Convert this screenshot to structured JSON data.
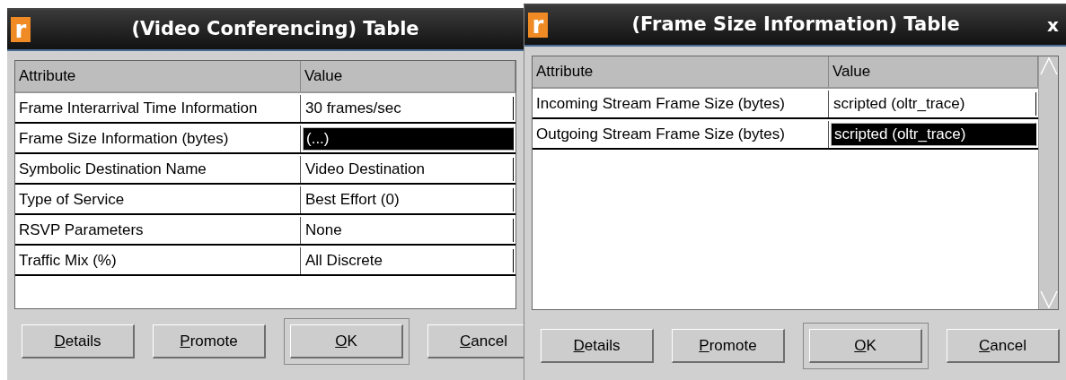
{
  "windows": [
    {
      "title": "(Video Conferencing) Table",
      "app_icon": "r",
      "scrollbar": false,
      "table": {
        "columns": [
          "Attribute",
          "Value"
        ],
        "rows": [
          {
            "attribute": "Frame Interarrival Time Information",
            "value": "30 frames/sec",
            "selected": false
          },
          {
            "attribute": "Frame Size Information (bytes)",
            "value": "(...)",
            "selected": true
          },
          {
            "attribute": "Symbolic Destination Name",
            "value": "Video Destination",
            "selected": false
          },
          {
            "attribute": "Type of Service",
            "value": "Best Effort (0)",
            "selected": false
          },
          {
            "attribute": "RSVP Parameters",
            "value": "None",
            "selected": false
          },
          {
            "attribute": "Traffic Mix (%)",
            "value": "All Discrete",
            "selected": false
          }
        ]
      },
      "buttons": [
        {
          "label": "Details",
          "default": false
        },
        {
          "label": "Promote",
          "default": false
        },
        {
          "label": "OK",
          "default": true
        },
        {
          "label": "Cancel",
          "default": false
        }
      ]
    },
    {
      "title": "(Frame Size Information) Table",
      "app_icon": "r",
      "close": "x",
      "scrollbar": true,
      "table": {
        "columns": [
          "Attribute",
          "Value"
        ],
        "rows": [
          {
            "attribute": "Incoming Stream Frame Size (bytes)",
            "value": "scripted (oltr_trace)",
            "selected": false
          },
          {
            "attribute": "Outgoing Stream Frame Size (bytes)",
            "value": "scripted (oltr_trace)",
            "selected": true
          }
        ]
      },
      "buttons": [
        {
          "label": "Details",
          "default": false
        },
        {
          "label": "Promote",
          "default": false
        },
        {
          "label": "OK",
          "default": true
        },
        {
          "label": "Cancel",
          "default": false
        }
      ]
    }
  ]
}
